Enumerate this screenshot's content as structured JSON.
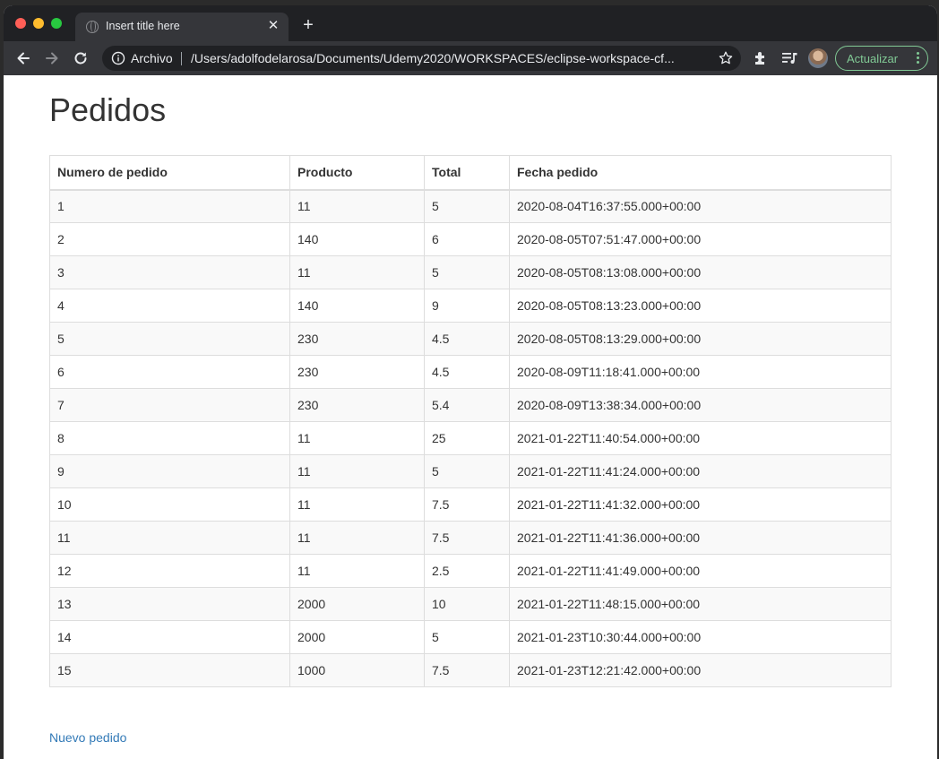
{
  "browser": {
    "tab_title": "Insert title here",
    "new_tab_symbol": "+",
    "address_scheme_label": "Archivo",
    "address_url": "/Users/adolfodelarosa/Documents/Udemy2020/WORKSPACES/eclipse-workspace-cf...",
    "update_button_label": "Actualizar",
    "icons": [
      "back-icon",
      "forward-icon",
      "reload-icon",
      "info-icon",
      "star-icon",
      "extensions-icon",
      "media-control-icon",
      "profile-avatar",
      "menu-icon"
    ],
    "colors": {
      "tab_bar": "#202124",
      "toolbar": "#35363a",
      "update_accent": "#81c995"
    }
  },
  "page": {
    "title": "Pedidos",
    "table": {
      "headers": [
        "Numero de pedido",
        "Producto",
        "Total",
        "Fecha pedido"
      ],
      "rows": [
        [
          "1",
          "11",
          "5",
          "2020-08-04T16:37:55.000+00:00"
        ],
        [
          "2",
          "140",
          "6",
          "2020-08-05T07:51:47.000+00:00"
        ],
        [
          "3",
          "11",
          "5",
          "2020-08-05T08:13:08.000+00:00"
        ],
        [
          "4",
          "140",
          "9",
          "2020-08-05T08:13:23.000+00:00"
        ],
        [
          "5",
          "230",
          "4.5",
          "2020-08-05T08:13:29.000+00:00"
        ],
        [
          "6",
          "230",
          "4.5",
          "2020-08-09T11:18:41.000+00:00"
        ],
        [
          "7",
          "230",
          "5.4",
          "2020-08-09T13:38:34.000+00:00"
        ],
        [
          "8",
          "11",
          "25",
          "2021-01-22T11:40:54.000+00:00"
        ],
        [
          "9",
          "11",
          "5",
          "2021-01-22T11:41:24.000+00:00"
        ],
        [
          "10",
          "11",
          "7.5",
          "2021-01-22T11:41:32.000+00:00"
        ],
        [
          "11",
          "11",
          "7.5",
          "2021-01-22T11:41:36.000+00:00"
        ],
        [
          "12",
          "11",
          "2.5",
          "2021-01-22T11:41:49.000+00:00"
        ],
        [
          "13",
          "2000",
          "10",
          "2021-01-22T11:48:15.000+00:00"
        ],
        [
          "14",
          "2000",
          "5",
          "2021-01-23T10:30:44.000+00:00"
        ],
        [
          "15",
          "1000",
          "7.5",
          "2021-01-23T12:21:42.000+00:00"
        ]
      ]
    },
    "new_order_link": "Nuevo pedido",
    "colors": {
      "link": "#337ab7",
      "stripe": "#f9f9f9",
      "border": "#dddddd"
    }
  }
}
